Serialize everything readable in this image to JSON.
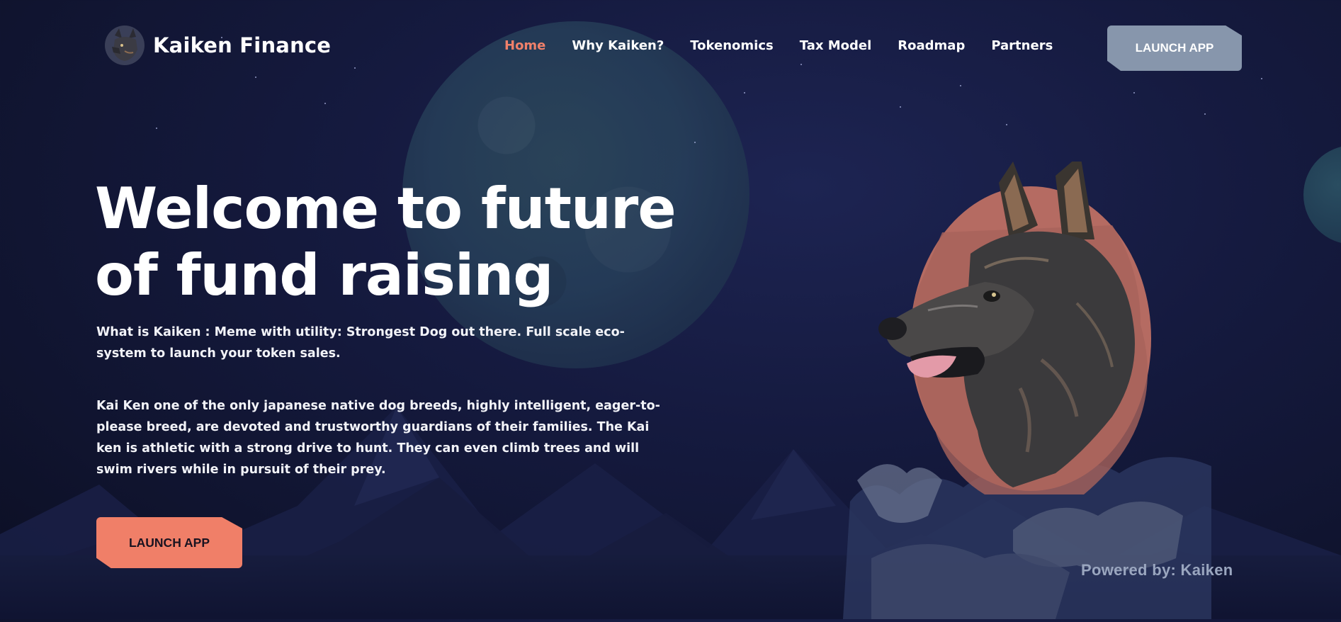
{
  "brand": {
    "name": "Kaiken Finance"
  },
  "nav": {
    "items": [
      {
        "label": "Home",
        "active": true
      },
      {
        "label": "Why Kaiken?",
        "active": false
      },
      {
        "label": "Tokenomics",
        "active": false
      },
      {
        "label": "Tax Model",
        "active": false
      },
      {
        "label": "Roadmap",
        "active": false
      },
      {
        "label": "Partners",
        "active": false
      }
    ],
    "launch_label": "LAUNCH APP"
  },
  "hero": {
    "title_line1": "Welcome to future",
    "title_line2": "of fund raising",
    "subtitle": "What is Kaiken : Meme with utility: Strongest Dog out there. Full scale eco-system to launch your token sales.",
    "description": "Kai Ken one of the only japanese native dog breeds, highly intelligent, eager-to-please breed, are devoted and trustworthy guardians of their families. The Kai ken is athletic with a strong drive to hunt. They can even climb trees and will swim rivers while in pursuit of their prey.",
    "launch_label": "LAUNCH APP"
  },
  "footer": {
    "powered_by": "Powered by: Kaiken"
  },
  "colors": {
    "accent": "#f07f68",
    "nav_button": "#8796ac",
    "background": "#151a3f"
  }
}
